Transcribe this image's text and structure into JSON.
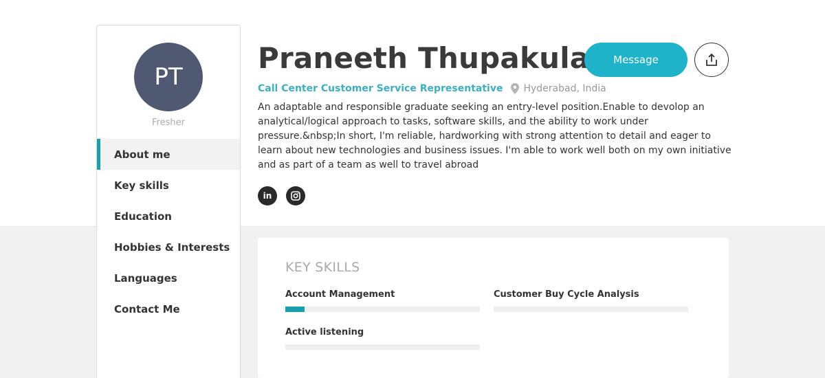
{
  "profile": {
    "initials": "PT",
    "status": "Fresher",
    "name": "Praneeth Thupakula",
    "job_title": "Call Center Customer Service Representative",
    "location": "Hyderabad, India",
    "about": "An adaptable and responsible graduate seeking an entry-level position.Enable to devolop an analytical/logical approach to tasks, software skills, and the ability to work under pressure.&nbsp;In short, I'm reliable, hardworking with strong attention to detail and eager to learn about new technologies and business issues. I'm able to work well both on my own initiative and as part of a team as well to travel abroad"
  },
  "actions": {
    "message_label": "Message",
    "share_icon": "share-icon"
  },
  "social": [
    {
      "icon": "linkedin-icon",
      "glyph": "in"
    },
    {
      "icon": "instagram-icon"
    }
  ],
  "nav": {
    "items": [
      {
        "label": "About me",
        "active": true
      },
      {
        "label": "Key skills"
      },
      {
        "label": "Education"
      },
      {
        "label": "Hobbies & Interests"
      },
      {
        "label": "Languages"
      },
      {
        "label": "Contact Me"
      }
    ]
  },
  "key_skills": {
    "title": "KEY SKILLS",
    "skills": [
      {
        "name": "Account Management",
        "level": 0.1
      },
      {
        "name": "Customer Buy Cycle Analysis",
        "level": 0
      },
      {
        "name": "Active listening",
        "level": 0
      }
    ]
  },
  "colors": {
    "accent": "#1a9fae",
    "button": "#1fb3ca",
    "avatar": "#4f5a72"
  }
}
